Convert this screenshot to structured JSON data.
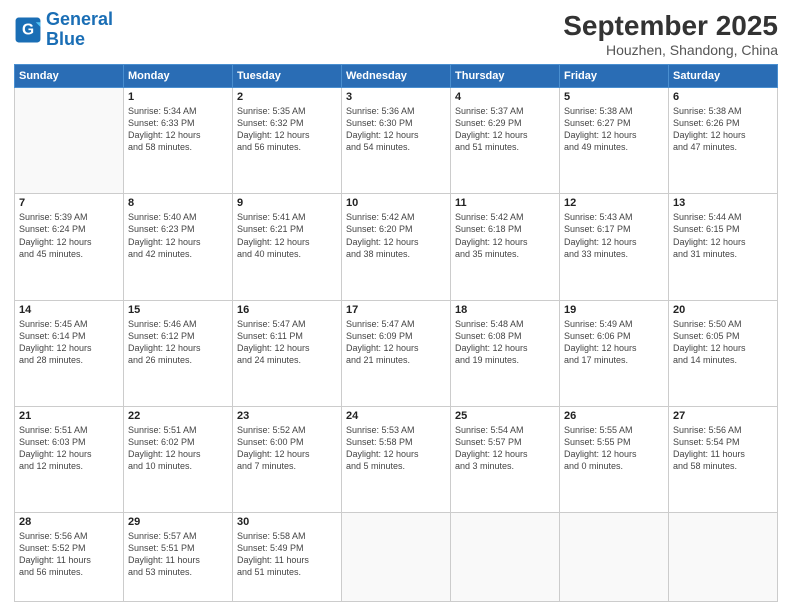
{
  "logo": {
    "line1": "General",
    "line2": "Blue"
  },
  "title": "September 2025",
  "subtitle": "Houzhen, Shandong, China",
  "weekdays": [
    "Sunday",
    "Monday",
    "Tuesday",
    "Wednesday",
    "Thursday",
    "Friday",
    "Saturday"
  ],
  "weeks": [
    [
      {
        "day": "",
        "text": ""
      },
      {
        "day": "1",
        "text": "Sunrise: 5:34 AM\nSunset: 6:33 PM\nDaylight: 12 hours\nand 58 minutes."
      },
      {
        "day": "2",
        "text": "Sunrise: 5:35 AM\nSunset: 6:32 PM\nDaylight: 12 hours\nand 56 minutes."
      },
      {
        "day": "3",
        "text": "Sunrise: 5:36 AM\nSunset: 6:30 PM\nDaylight: 12 hours\nand 54 minutes."
      },
      {
        "day": "4",
        "text": "Sunrise: 5:37 AM\nSunset: 6:29 PM\nDaylight: 12 hours\nand 51 minutes."
      },
      {
        "day": "5",
        "text": "Sunrise: 5:38 AM\nSunset: 6:27 PM\nDaylight: 12 hours\nand 49 minutes."
      },
      {
        "day": "6",
        "text": "Sunrise: 5:38 AM\nSunset: 6:26 PM\nDaylight: 12 hours\nand 47 minutes."
      }
    ],
    [
      {
        "day": "7",
        "text": "Sunrise: 5:39 AM\nSunset: 6:24 PM\nDaylight: 12 hours\nand 45 minutes."
      },
      {
        "day": "8",
        "text": "Sunrise: 5:40 AM\nSunset: 6:23 PM\nDaylight: 12 hours\nand 42 minutes."
      },
      {
        "day": "9",
        "text": "Sunrise: 5:41 AM\nSunset: 6:21 PM\nDaylight: 12 hours\nand 40 minutes."
      },
      {
        "day": "10",
        "text": "Sunrise: 5:42 AM\nSunset: 6:20 PM\nDaylight: 12 hours\nand 38 minutes."
      },
      {
        "day": "11",
        "text": "Sunrise: 5:42 AM\nSunset: 6:18 PM\nDaylight: 12 hours\nand 35 minutes."
      },
      {
        "day": "12",
        "text": "Sunrise: 5:43 AM\nSunset: 6:17 PM\nDaylight: 12 hours\nand 33 minutes."
      },
      {
        "day": "13",
        "text": "Sunrise: 5:44 AM\nSunset: 6:15 PM\nDaylight: 12 hours\nand 31 minutes."
      }
    ],
    [
      {
        "day": "14",
        "text": "Sunrise: 5:45 AM\nSunset: 6:14 PM\nDaylight: 12 hours\nand 28 minutes."
      },
      {
        "day": "15",
        "text": "Sunrise: 5:46 AM\nSunset: 6:12 PM\nDaylight: 12 hours\nand 26 minutes."
      },
      {
        "day": "16",
        "text": "Sunrise: 5:47 AM\nSunset: 6:11 PM\nDaylight: 12 hours\nand 24 minutes."
      },
      {
        "day": "17",
        "text": "Sunrise: 5:47 AM\nSunset: 6:09 PM\nDaylight: 12 hours\nand 21 minutes."
      },
      {
        "day": "18",
        "text": "Sunrise: 5:48 AM\nSunset: 6:08 PM\nDaylight: 12 hours\nand 19 minutes."
      },
      {
        "day": "19",
        "text": "Sunrise: 5:49 AM\nSunset: 6:06 PM\nDaylight: 12 hours\nand 17 minutes."
      },
      {
        "day": "20",
        "text": "Sunrise: 5:50 AM\nSunset: 6:05 PM\nDaylight: 12 hours\nand 14 minutes."
      }
    ],
    [
      {
        "day": "21",
        "text": "Sunrise: 5:51 AM\nSunset: 6:03 PM\nDaylight: 12 hours\nand 12 minutes."
      },
      {
        "day": "22",
        "text": "Sunrise: 5:51 AM\nSunset: 6:02 PM\nDaylight: 12 hours\nand 10 minutes."
      },
      {
        "day": "23",
        "text": "Sunrise: 5:52 AM\nSunset: 6:00 PM\nDaylight: 12 hours\nand 7 minutes."
      },
      {
        "day": "24",
        "text": "Sunrise: 5:53 AM\nSunset: 5:58 PM\nDaylight: 12 hours\nand 5 minutes."
      },
      {
        "day": "25",
        "text": "Sunrise: 5:54 AM\nSunset: 5:57 PM\nDaylight: 12 hours\nand 3 minutes."
      },
      {
        "day": "26",
        "text": "Sunrise: 5:55 AM\nSunset: 5:55 PM\nDaylight: 12 hours\nand 0 minutes."
      },
      {
        "day": "27",
        "text": "Sunrise: 5:56 AM\nSunset: 5:54 PM\nDaylight: 11 hours\nand 58 minutes."
      }
    ],
    [
      {
        "day": "28",
        "text": "Sunrise: 5:56 AM\nSunset: 5:52 PM\nDaylight: 11 hours\nand 56 minutes."
      },
      {
        "day": "29",
        "text": "Sunrise: 5:57 AM\nSunset: 5:51 PM\nDaylight: 11 hours\nand 53 minutes."
      },
      {
        "day": "30",
        "text": "Sunrise: 5:58 AM\nSunset: 5:49 PM\nDaylight: 11 hours\nand 51 minutes."
      },
      {
        "day": "",
        "text": ""
      },
      {
        "day": "",
        "text": ""
      },
      {
        "day": "",
        "text": ""
      },
      {
        "day": "",
        "text": ""
      }
    ]
  ]
}
